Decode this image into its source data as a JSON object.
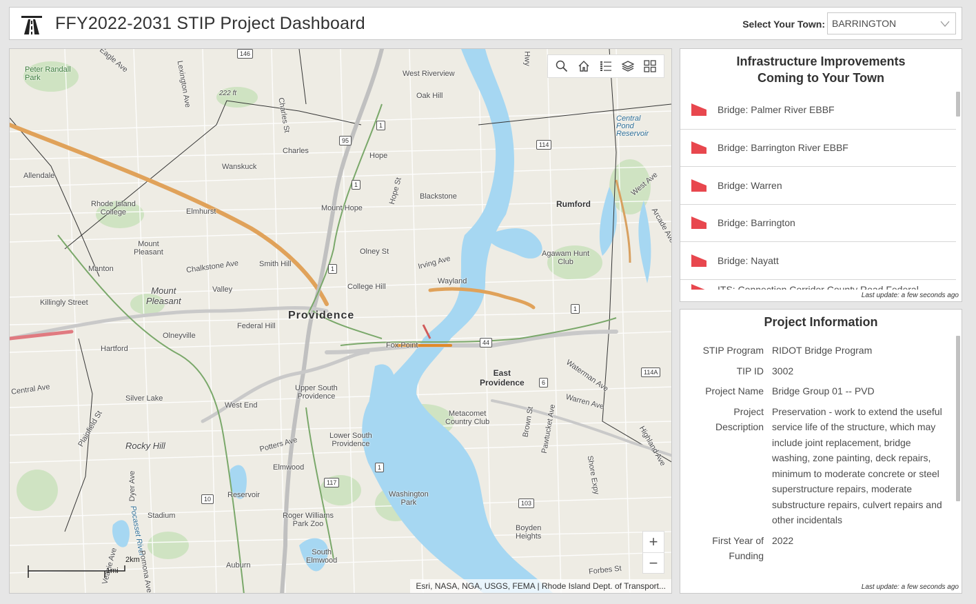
{
  "header": {
    "title": "FFY2022-2031 STIP Project Dashboard",
    "town_label": "Select Your Town:",
    "town_value": "BARRINGTON"
  },
  "map": {
    "attribution": "Esri, NASA, NGA, USGS, FEMA | Rhode Island Dept. of Transport...",
    "scale_km": "2km",
    "scale_mi": "1mi",
    "zoom_in": "+",
    "zoom_out": "−",
    "toolbar_icons": [
      "search-icon",
      "home-icon",
      "legend-icon",
      "layers-icon",
      "basemap-gallery-icon"
    ],
    "labels": {
      "providence": "Providence",
      "east_providence": "East\nProvidence",
      "peter_randall_park": "Peter Randall\nPark",
      "west_riverview": "West Riverview",
      "oak_hill": "Oak Hill",
      "central_pond": "Central\nPond\nReservoir",
      "elev_222": "222 ft",
      "charles": "Charles",
      "hope": "Hope",
      "wanskuck": "Wanskuck",
      "allendale": "Allendale",
      "ric": "Rhode Island\nCollege",
      "elmhurst": "Elmhurst",
      "mount_hope": "Mount Hope",
      "blackstone": "Blackstone",
      "rumford": "Rumford",
      "mount_pleasant_small": "Mount\nPleasant",
      "mount_pleasant": "Mount\nPleasant",
      "manton": "Manton",
      "chalkstone": "Chalkstone Ave",
      "smith_hill": "Smith Hill",
      "olney_st": "Olney St",
      "irving_ave": "Irving Ave",
      "agawam": "Agawam Hunt\nClub",
      "killingly": "Killingly Street",
      "valley": "Valley",
      "college_hill": "College Hill",
      "wayland": "Wayland",
      "federal_hill": "Federal Hill",
      "olneyville": "Olneyville",
      "hartford": "Hartford",
      "fox_point": "Fox Point",
      "central_ave": "Central Ave",
      "silver_lake": "Silver Lake",
      "upper_south": "Upper South\nProvidence",
      "west_end": "West End",
      "metacomet": "Metacomet\nCountry Club",
      "waterman": "Waterman Ave",
      "warren_ave": "Warren Ave",
      "rocky_hill": "Rocky Hill",
      "lower_south": "Lower South\nProvidence",
      "potters": "Potters Ave",
      "elmwood": "Elmwood",
      "reservoir": "Reservoir",
      "washington_park": "Washington\nPark",
      "stadium": "Stadium",
      "roger_williams": "Roger Williams\nPark Zoo",
      "boyden": "Boyden\nHeights",
      "south_elmwood": "South\nElmwood",
      "auburn": "Auburn",
      "forbes": "Forbes St",
      "arcade": "Arcade Ave",
      "west_ave": "West Ave",
      "highland": "Highland Ave",
      "brown_st": "Brown St",
      "pawtucket_ave": "Pawtucket Ave",
      "hope_st": "Hope St",
      "charles_st": "Charles St",
      "lexington": "Lexington Ave",
      "dyer": "Dyer Ave",
      "pocasset": "Pocasset River",
      "plainfield": "Plainfield St",
      "eagle": "Eagle Ave",
      "hwy": "Hwy",
      "veazie": "Veazie Ave",
      "pomona": "Pomona Ave",
      "shore_expy": "Shore Expy"
    },
    "shields": [
      "146",
      "95",
      "1",
      "1",
      "114",
      "1",
      "44",
      "6",
      "114A",
      "1",
      "117",
      "10",
      "103",
      "1"
    ]
  },
  "infrastructure": {
    "title_line1": "Infrastructure Improvements",
    "title_line2": "Coming to Your Town",
    "items": [
      {
        "label": "Bridge: Palmer River EBBF"
      },
      {
        "label": "Bridge: Barrington River EBBF"
      },
      {
        "label": "Bridge: Warren"
      },
      {
        "label": "Bridge: Barrington"
      },
      {
        "label": "Bridge: Nayatt"
      },
      {
        "label": "ITS: Connection Corridor County Road Federal"
      }
    ],
    "last_update": "Last update: a few seconds ago",
    "flag_color": "#e8474e"
  },
  "project_info": {
    "title": "Project Information",
    "rows": [
      {
        "key": "STIP Program",
        "value": "RIDOT Bridge Program"
      },
      {
        "key": "TIP ID",
        "value": "3002"
      },
      {
        "key": "Project Name",
        "value": "Bridge Group 01 -- PVD"
      },
      {
        "key": "Project\nDescription",
        "value": "Preservation - work to extend the useful service life of the structure, which may include joint replacement, bridge washing, zone painting, deck repairs, minimum to moderate concrete or steel superstructure repairs, moderate substructure repairs, culvert repairs and other incidentals"
      },
      {
        "key": "First Year of\nFunding",
        "value": "2022"
      }
    ],
    "last_update": "Last update: a few seconds ago"
  }
}
